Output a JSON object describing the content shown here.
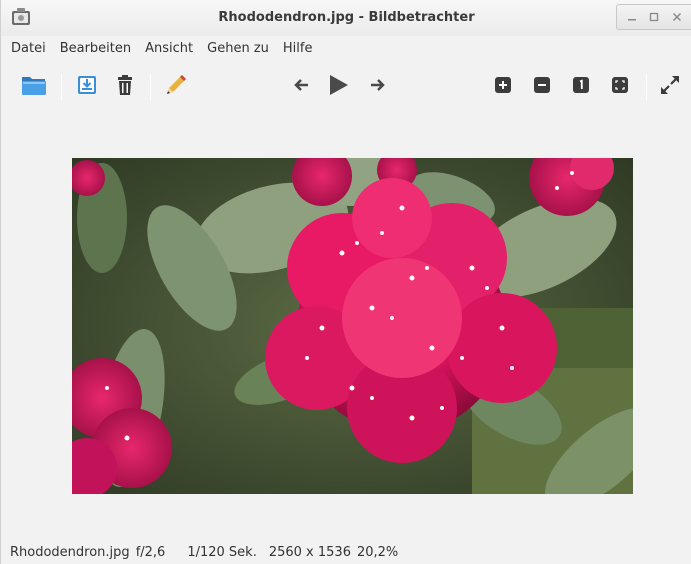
{
  "window": {
    "title": "Rhododendron.jpg - Bildbetrachter",
    "app_icon": "image-viewer-icon"
  },
  "menubar": {
    "items": [
      {
        "label": "Datei"
      },
      {
        "label": "Bearbeiten"
      },
      {
        "label": "Ansicht"
      },
      {
        "label": "Gehen zu"
      },
      {
        "label": "Hilfe"
      }
    ]
  },
  "toolbar": {
    "buttons": [
      {
        "icon": "folder-open-icon"
      },
      {
        "icon": "save-icon"
      },
      {
        "icon": "trash-icon"
      },
      {
        "icon": "pencil-icon"
      },
      {
        "icon": "arrow-left-icon"
      },
      {
        "icon": "play-icon"
      },
      {
        "icon": "arrow-right-icon"
      },
      {
        "icon": "zoom-in-icon"
      },
      {
        "icon": "zoom-out-icon"
      },
      {
        "icon": "zoom-original-icon"
      },
      {
        "icon": "zoom-fit-icon"
      },
      {
        "icon": "fullscreen-icon"
      }
    ]
  },
  "image": {
    "subject": "rhododendron-photo"
  },
  "statusbar": {
    "filename": "Rhododendron.jpg",
    "aperture": "f/2,6",
    "exposure": "1/120 Sek.",
    "dimensions": "2560 x 1536",
    "zoom": "20,2%"
  },
  "colors": {
    "accent_blue": "#3a8fd8",
    "icon_dark": "#3c3c3c",
    "flower_magenta": "#d8145e",
    "leaf_green": "#6e8a5e"
  }
}
